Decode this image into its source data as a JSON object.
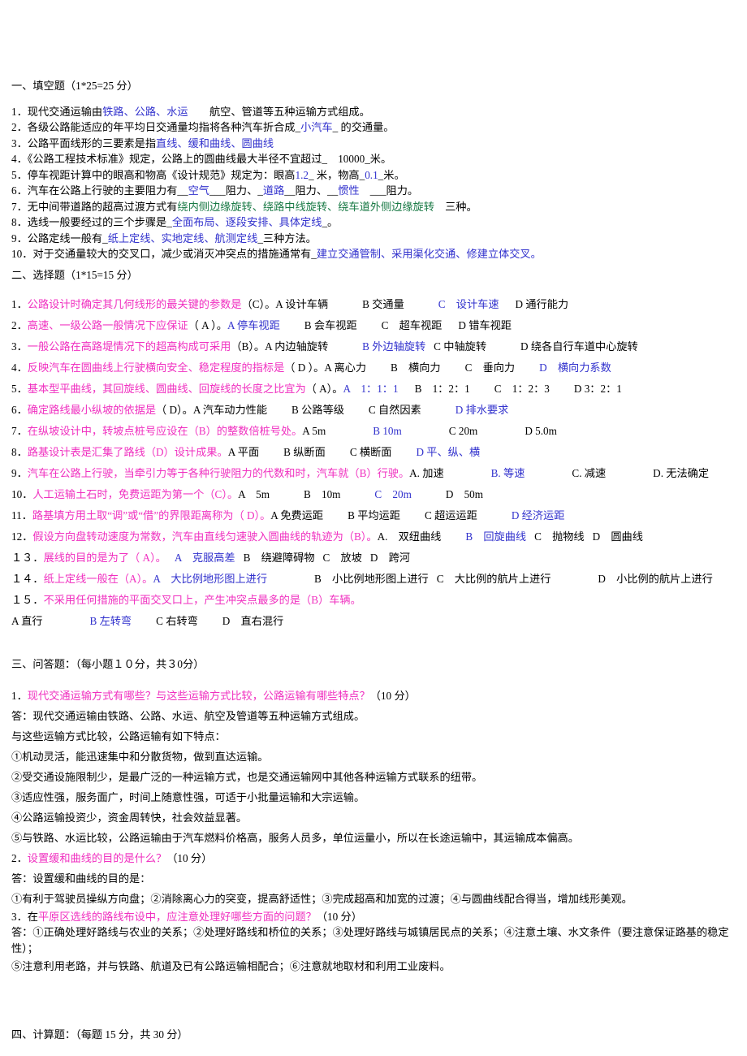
{
  "document": {
    "type": "exam-paper",
    "language": "zh-CN"
  },
  "sections": {
    "fill_in_blank": {
      "heading": "一、填空题（1*25=25 分）",
      "items": [
        {
          "number": "1．",
          "pre": "现代交通运输由",
          "answer": "铁路、公路、水运",
          "post": "　　航空、管道等五种运输方式组成。",
          "answer_color": "blue"
        },
        {
          "number": "2．",
          "pre": "各级公路能适应的年平均日交通量均指将各种汽车折合成_",
          "answer": "小汽车",
          "post": "_ 的交通量。",
          "answer_color": "blue"
        },
        {
          "number": "3．",
          "pre": "公路平面线形的三要素是指",
          "answer": "直线、缓和曲线、圆曲线",
          "post": "",
          "answer_color": "blue"
        },
        {
          "number": "4．",
          "pre": "《公路工程技术标准》规定，公路上的圆曲线最大半径不宜超过_",
          "answer": "　10000",
          "post": "_米。",
          "answer_color": "black"
        },
        {
          "number": "5．",
          "pre": "停车视距计算中的眼高和物高《设计规范》规定为：眼高",
          "answer": "1.2",
          "mid": "_ 米，物高_",
          "answer2": "0.1",
          "post": "_米。",
          "answer_color": "blue"
        },
        {
          "number": "6．",
          "pre": "汽车在公路上行驶的主要阻力有__",
          "answer": "空气",
          "mid": "___阻力、_",
          "answer2": "道路",
          "mid2": "__阻力、__",
          "answer3": "惯性",
          "post": "　___阻力。",
          "answer_color": "blue"
        },
        {
          "number": "7．",
          "pre": "无中间带道路的超高过渡方式有",
          "answer": "绕内侧边缘旋转、绕路中线旋转、绕车道外侧边缘旋转",
          "post": "　三种。",
          "answer_color": "green"
        },
        {
          "number": "8．",
          "pre": "选线一般要经过的三个步骤是_",
          "answer": "全面布局、逐段安排、具体定线",
          "post": "_。",
          "answer_color": "blue"
        },
        {
          "number": "9．",
          "pre": "公路定线一般有_",
          "answer": "纸上定线、实地定线、航测定线",
          "post": "_三种方法。",
          "answer_color": "blue"
        },
        {
          "number": "10．",
          "pre": "对于交通量较大的交叉口，减少或消灭冲突点的措施通常有_",
          "answer": "建立交通管制、采用渠化交通、修建立体交叉。",
          "post": "",
          "answer_color": "blue"
        }
      ]
    },
    "multiple_choice": {
      "heading": "二、选择题（1*15=15 分）",
      "items": [
        {
          "number": "1．",
          "question": "公路设计时确定其几何线形的最关键的参数是",
          "bracket": "（C）。",
          "options": [
            {
              "label": "A",
              "text": "设计车辆",
              "correct": false
            },
            {
              "label": "B",
              "text": "交通量",
              "correct": false
            },
            {
              "label": "C",
              "text": "设计车速",
              "correct": true
            },
            {
              "label": "D",
              "text": "通行能力",
              "correct": false
            }
          ]
        },
        {
          "number": "2．",
          "question": "高速、一级公路一般情况下应保证",
          "bracket": "（ A ）。",
          "options": [
            {
              "label": "A",
              "text": "停车视距",
              "correct": true
            },
            {
              "label": "B",
              "text": "会车视距",
              "correct": false
            },
            {
              "label": "C",
              "text": "超车视距",
              "correct": false
            },
            {
              "label": "D",
              "text": "错车视距",
              "correct": false
            }
          ]
        },
        {
          "number": "3．",
          "question": "一般公路在高路堤情况下的超高构成可采用",
          "bracket": "（B）。",
          "options": [
            {
              "label": "A",
              "text": "内边轴旋转",
              "correct": false
            },
            {
              "label": "B",
              "text": "外边轴旋转",
              "correct": true
            },
            {
              "label": "C",
              "text": "中轴旋转",
              "correct": false
            },
            {
              "label": "D",
              "text": "绕各自行车道中心旋转",
              "correct": false
            }
          ]
        },
        {
          "number": "4．",
          "question": "反映汽车在圆曲线上行驶横向安全、稳定程度的指标是",
          "bracket": "（ D ）。",
          "options": [
            {
              "label": "A",
              "text": "离心力",
              "correct": false
            },
            {
              "label": "B",
              "text": "横向力",
              "correct": false
            },
            {
              "label": "C",
              "text": "垂向力",
              "correct": false
            },
            {
              "label": "D",
              "text": "横向力系数",
              "correct": true
            }
          ]
        },
        {
          "number": "5．",
          "question": "基本型平曲线，其回旋线、圆曲线、回旋线的长度之比宜为",
          "bracket": "（ A）。",
          "options": [
            {
              "label": "A",
              "text": "1：1：1",
              "correct": true
            },
            {
              "label": "B",
              "text": "1：2：1",
              "correct": false
            },
            {
              "label": "C",
              "text": "1：2：3",
              "correct": false
            },
            {
              "label": "D",
              "text": "3：2：1",
              "correct": false
            }
          ]
        },
        {
          "number": "6．",
          "question": "确定路线最小纵坡的依据是",
          "bracket": "（ D）。",
          "options": [
            {
              "label": "A",
              "text": "汽车动力性能",
              "correct": false
            },
            {
              "label": "B",
              "text": "公路等级",
              "correct": false
            },
            {
              "label": "C",
              "text": "自然因素",
              "correct": false
            },
            {
              "label": "D",
              "text": "排水要求",
              "correct": true
            }
          ]
        },
        {
          "number": "7．",
          "question": "在纵坡设计中，转坡点桩号应设在（B）的整数倍桩号处。",
          "bracket": "",
          "options": [
            {
              "label": "A",
              "text": "5m",
              "correct": false
            },
            {
              "label": "B",
              "text": "10m",
              "correct": true
            },
            {
              "label": "C",
              "text": "20m",
              "correct": false
            },
            {
              "label": "D",
              "text": "5.0m",
              "correct": false
            }
          ]
        },
        {
          "number": "8．",
          "question": "路基设计表是汇集了路线（D）设计成果。",
          "bracket": "",
          "options": [
            {
              "label": "A",
              "text": "平面",
              "correct": false
            },
            {
              "label": "B",
              "text": "纵断面",
              "correct": false
            },
            {
              "label": "C",
              "text": "横断面",
              "correct": false
            },
            {
              "label": "D",
              "text": "平、纵、横",
              "correct": true
            }
          ]
        },
        {
          "number": "9．",
          "question": "汽车在公路上行驶，当牵引力等于各种行驶阻力的代数和时，汽车就（B）行驶。",
          "bracket": "",
          "options": [
            {
              "label": "A.",
              "text": "加速",
              "correct": false
            },
            {
              "label": "B.",
              "text": "等速",
              "correct": true
            },
            {
              "label": "C.",
              "text": "减速",
              "correct": false
            },
            {
              "label": "D.",
              "text": "无法确定",
              "correct": false
            }
          ]
        },
        {
          "number": "10．",
          "question": "人工运输土石时，免费运距为第一个（C）。",
          "bracket": "",
          "options": [
            {
              "label": "A",
              "text": "5m",
              "correct": false
            },
            {
              "label": "B",
              "text": "10m",
              "correct": false
            },
            {
              "label": "C",
              "text": "20m",
              "correct": true
            },
            {
              "label": "D",
              "text": "50m",
              "correct": false
            }
          ]
        },
        {
          "number": "11．",
          "question": "路基填方用土取“调”或“借”的界限距离称为（ D）。",
          "bracket": "",
          "options": [
            {
              "label": "A",
              "text": "免费运距",
              "correct": false
            },
            {
              "label": "B",
              "text": "平均运距",
              "correct": false
            },
            {
              "label": "C",
              "text": "超运运距",
              "correct": false
            },
            {
              "label": "D",
              "text": "经济运距",
              "correct": true
            }
          ]
        },
        {
          "number": "12．",
          "question": "假设方向盘转动速度为常数，汽车由直线匀速驶入圆曲线的轨迹为（B）。",
          "bracket": "",
          "options": [
            {
              "label": "A.",
              "text": "双纽曲线",
              "correct": false
            },
            {
              "label": "B",
              "text": "回旋曲线",
              "correct": true
            },
            {
              "label": "C",
              "text": "抛物线",
              "correct": false
            },
            {
              "label": "D",
              "text": "圆曲线",
              "correct": false
            }
          ]
        },
        {
          "number": "１３．",
          "question": "展线的目的是为了（ A）。",
          "bracket": "",
          "options": [
            {
              "label": "A",
              "text": "克服高差",
              "correct": true
            },
            {
              "label": "B",
              "text": "绕避障碍物",
              "correct": false
            },
            {
              "label": "C",
              "text": "放坡",
              "correct": false
            },
            {
              "label": "D",
              "text": "跨河",
              "correct": false
            }
          ]
        },
        {
          "number": "１４．",
          "question": "纸上定线一般在（A）。",
          "bracket": "",
          "options": [
            {
              "label": "A",
              "text": "大比例地形图上进行",
              "correct": true
            },
            {
              "label": "B",
              "text": "小比例地形图上进行",
              "correct": false
            },
            {
              "label": "C",
              "text": "大比例的航片上进行",
              "correct": false
            },
            {
              "label": "D",
              "text": "小比例的航片上进行",
              "correct": false
            }
          ]
        },
        {
          "number": "１５．",
          "question": "不采用任何措施的平面交叉口上，产生冲突点最多的是（B）车辆。",
          "bracket": "",
          "options": [
            {
              "label": "A",
              "text": "直行",
              "correct": false
            },
            {
              "label": "B",
              "text": "左转弯",
              "correct": true
            },
            {
              "label": "C",
              "text": "右转弯",
              "correct": false
            },
            {
              "label": "D",
              "text": "直右混行",
              "correct": false
            }
          ]
        }
      ]
    },
    "short_answer": {
      "heading": "三、问答题：（每小题１０分，共３0分）",
      "items": [
        {
          "number": "1．",
          "question": "现代交通运输方式有哪些？与这些运输方式比较，公路运输有哪些特点？",
          "points": "（10 分）",
          "answer_lines": [
            "答：现代交通运输由铁路、公路、水运、航空及管道等五种运输方式组成。",
            "与这些运输方式比较，公路运输有如下特点：",
            "①机动灵活，能迅速集中和分散货物，做到直达运输。",
            "②受交通设施限制少，是最广泛的一种运输方式，也是交通运输网中其他各种运输方式联系的纽带。",
            "③适应性强，服务面广，时间上随意性强，可适于小批量运输和大宗运输。",
            "④公路运输投资少，资金周转快，社会效益显著。",
            "⑤与铁路、水运比较，公路运输由于汽车燃料价格高，服务人员多，单位运量小，所以在长途运输中，其运输成本偏高。"
          ]
        },
        {
          "number": "2．",
          "question": "设置缓和曲线的目的是什么？",
          "points": "（10 分）",
          "answer_lines": [
            "答：设置缓和曲线的目的是：",
            "①有利于驾驶员操纵方向盘；②消除离心力的突变，提高舒适性；③完成超高和加宽的过渡；④与圆曲线配合得当，增加线形美观。"
          ]
        },
        {
          "number": "3．",
          "question_prefix": "在",
          "question": "平原区选线的路线布设中，应注意处理好哪些方面的问题？",
          "points": "（10 分）",
          "answer_lines": [
            "答：①正确处理好路线与农业的关系；②处理好路线和桥位的关系；③处理好路线与城镇居民点的关系；④注意土壤、水文条件（要注意保证路基的稳定",
            "性）；",
            "⑤注意利用老路，并与铁路、航道及已有公路运输相配合；⑥注意就地取材和利用工业废料。"
          ]
        }
      ]
    },
    "calculation": {
      "heading": "四、计算题：（每题 15 分，共 30 分）"
    }
  },
  "colors": {
    "blue": "#3232cd",
    "magenta": "#f030c0",
    "green": "#1a7a46",
    "black": "#000000"
  }
}
